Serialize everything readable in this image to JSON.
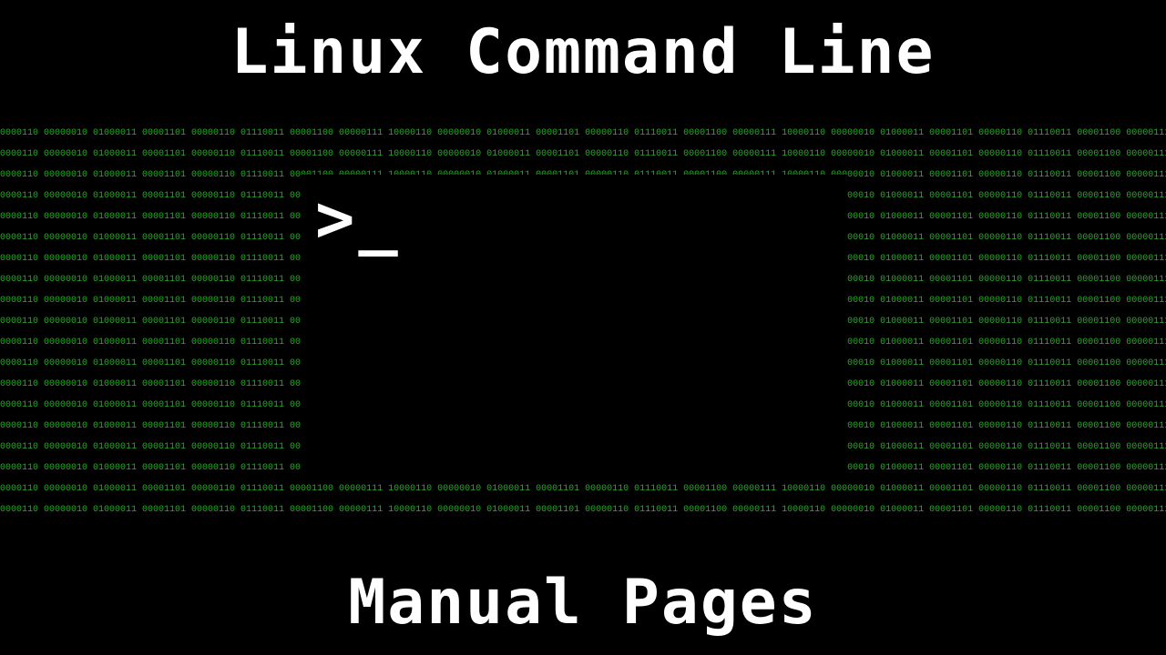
{
  "titles": {
    "top": "Linux Command Line",
    "bottom": "Manual Pages"
  },
  "prompt": ">_",
  "binary": {
    "segment": "10000110 00000010 01000011 00001101 00000110 01110011 00001100 00000111",
    "rows": 19
  },
  "colors": {
    "background": "#000000",
    "title_text": "#ffffff",
    "binary_text": "#1fb11f",
    "prompt_text": "#ffffff"
  }
}
